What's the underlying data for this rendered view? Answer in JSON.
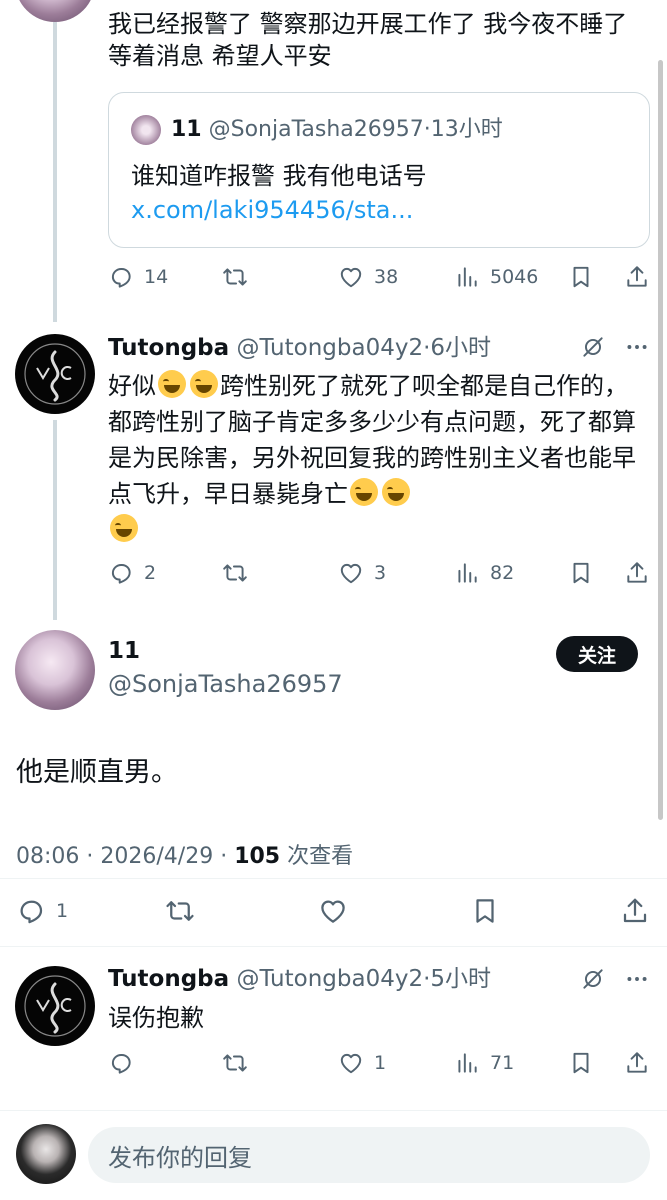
{
  "thread": {
    "post1": {
      "text": "我已经报警了 警察那边开展工作了 我今夜不睡了 等着消息 希望人平安",
      "quote": {
        "name": "11",
        "handle": "@SonjaTasha26957",
        "time": "13小时",
        "text": "谁知道咋报警 我有他电话号 ",
        "link": "x.com/laki954456/sta..."
      },
      "actions": {
        "replies": "14",
        "views": "5046",
        "likes": "38"
      }
    },
    "post2": {
      "name": "Tutongba",
      "handle": "@Tutongba04y2",
      "time": "6小时",
      "text_a": "好似",
      "text_b": "跨性别死了就死了呗全都是自己作的，都跨性别了脑子肯定多多少少有点问题，死了都算是为民除害，另外祝回复我的跨性别主义者也能早点飞升，早日暴毙身亡",
      "actions": {
        "replies": "2",
        "likes": "3",
        "views": "82"
      }
    }
  },
  "main_post": {
    "name": "11",
    "handle": "@SonjaTasha26957",
    "follow_label": "关注",
    "text": "他是顺直男。",
    "time": "08:06",
    "date": "2026/4/29",
    "views_count": "105",
    "views_label": "次查看",
    "actions": {
      "replies": "1"
    }
  },
  "reply": {
    "name": "Tutongba",
    "handle": "@Tutongba04y2",
    "time": "5小时",
    "text": "误伤抱歉",
    "actions": {
      "likes": "1",
      "views": "71"
    }
  },
  "composer": {
    "placeholder": "发布你的回复"
  },
  "colors": {
    "accent": "#1d9bf0",
    "text": "#0f1419",
    "muted": "#536471",
    "border": "#cfd9de"
  },
  "icons": [
    "reply-icon",
    "retweet-icon",
    "like-icon",
    "views-icon",
    "bookmark-icon",
    "share-icon",
    "grok-icon",
    "more-icon"
  ]
}
